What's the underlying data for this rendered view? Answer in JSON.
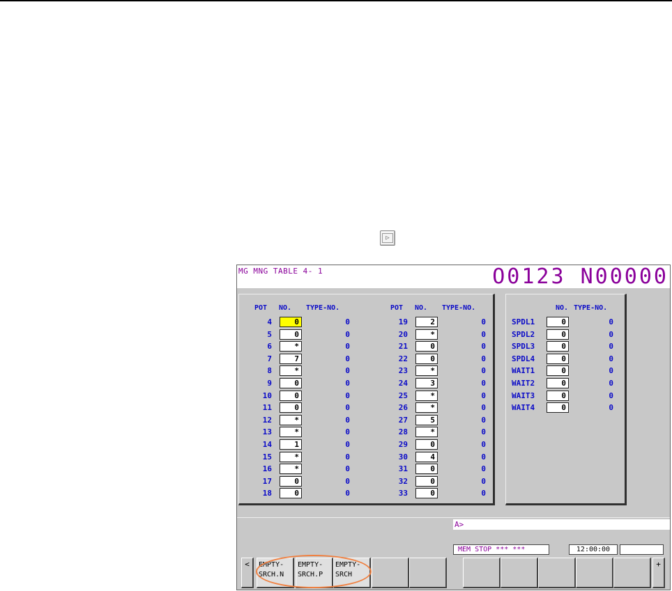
{
  "screen": {
    "title": "MG MNG TABLE 4-  1",
    "program": "O0123 N00000",
    "col_headers": {
      "pot": "POT",
      "no": "NO.",
      "type": "TYPE-NO."
    },
    "left_rows": [
      {
        "pot": "4",
        "no": "0",
        "type": "0",
        "selected": true
      },
      {
        "pot": "5",
        "no": "0",
        "type": "0"
      },
      {
        "pot": "6",
        "no": "*",
        "type": "0"
      },
      {
        "pot": "7",
        "no": "7",
        "type": "0"
      },
      {
        "pot": "8",
        "no": "*",
        "type": "0"
      },
      {
        "pot": "9",
        "no": "0",
        "type": "0"
      },
      {
        "pot": "10",
        "no": "0",
        "type": "0"
      },
      {
        "pot": "11",
        "no": "0",
        "type": "0"
      },
      {
        "pot": "12",
        "no": "*",
        "type": "0"
      },
      {
        "pot": "13",
        "no": "*",
        "type": "0"
      },
      {
        "pot": "14",
        "no": "1",
        "type": "0"
      },
      {
        "pot": "15",
        "no": "*",
        "type": "0"
      },
      {
        "pot": "16",
        "no": "*",
        "type": "0"
      },
      {
        "pot": "17",
        "no": "0",
        "type": "0"
      },
      {
        "pot": "18",
        "no": "0",
        "type": "0"
      }
    ],
    "mid_rows": [
      {
        "pot": "19",
        "no": "2",
        "type": "0"
      },
      {
        "pot": "20",
        "no": "*",
        "type": "0"
      },
      {
        "pot": "21",
        "no": "0",
        "type": "0"
      },
      {
        "pot": "22",
        "no": "0",
        "type": "0"
      },
      {
        "pot": "23",
        "no": "*",
        "type": "0"
      },
      {
        "pot": "24",
        "no": "3",
        "type": "0"
      },
      {
        "pot": "25",
        "no": "*",
        "type": "0"
      },
      {
        "pot": "26",
        "no": "*",
        "type": "0"
      },
      {
        "pot": "27",
        "no": "5",
        "type": "0"
      },
      {
        "pot": "28",
        "no": "*",
        "type": "0"
      },
      {
        "pot": "29",
        "no": "0",
        "type": "0"
      },
      {
        "pot": "30",
        "no": "4",
        "type": "0"
      },
      {
        "pot": "31",
        "no": "0",
        "type": "0"
      },
      {
        "pot": "32",
        "no": "0",
        "type": "0"
      },
      {
        "pot": "33",
        "no": "0",
        "type": "0"
      }
    ],
    "spdl_rows": [
      {
        "name": "SPDL1",
        "no": "0",
        "type": "0"
      },
      {
        "name": "SPDL2",
        "no": "0",
        "type": "0"
      },
      {
        "name": "SPDL3",
        "no": "0",
        "type": "0"
      },
      {
        "name": "SPDL4",
        "no": "0",
        "type": "0"
      },
      {
        "name": "WAIT1",
        "no": "0",
        "type": "0"
      },
      {
        "name": "WAIT2",
        "no": "0",
        "type": "0"
      },
      {
        "name": "WAIT3",
        "no": "0",
        "type": "0"
      },
      {
        "name": "WAIT4",
        "no": "0",
        "type": "0"
      }
    ],
    "input_prompt": "A>",
    "status_mode": "MEM  STOP *** ***",
    "clock": "12:00:00",
    "softkeys": {
      "prev": "<",
      "next": "+",
      "k1": "EMPTY- SRCH.N",
      "k2": "EMPTY- SRCH.P",
      "k3": "EMPTY- SRCH"
    }
  },
  "next_key_icon": "next-page-key-icon",
  "colors": {
    "title": "#8a009a",
    "label": "#0a0ac8",
    "cursor": "#ffff00",
    "highlight_oval": "#f08040"
  }
}
